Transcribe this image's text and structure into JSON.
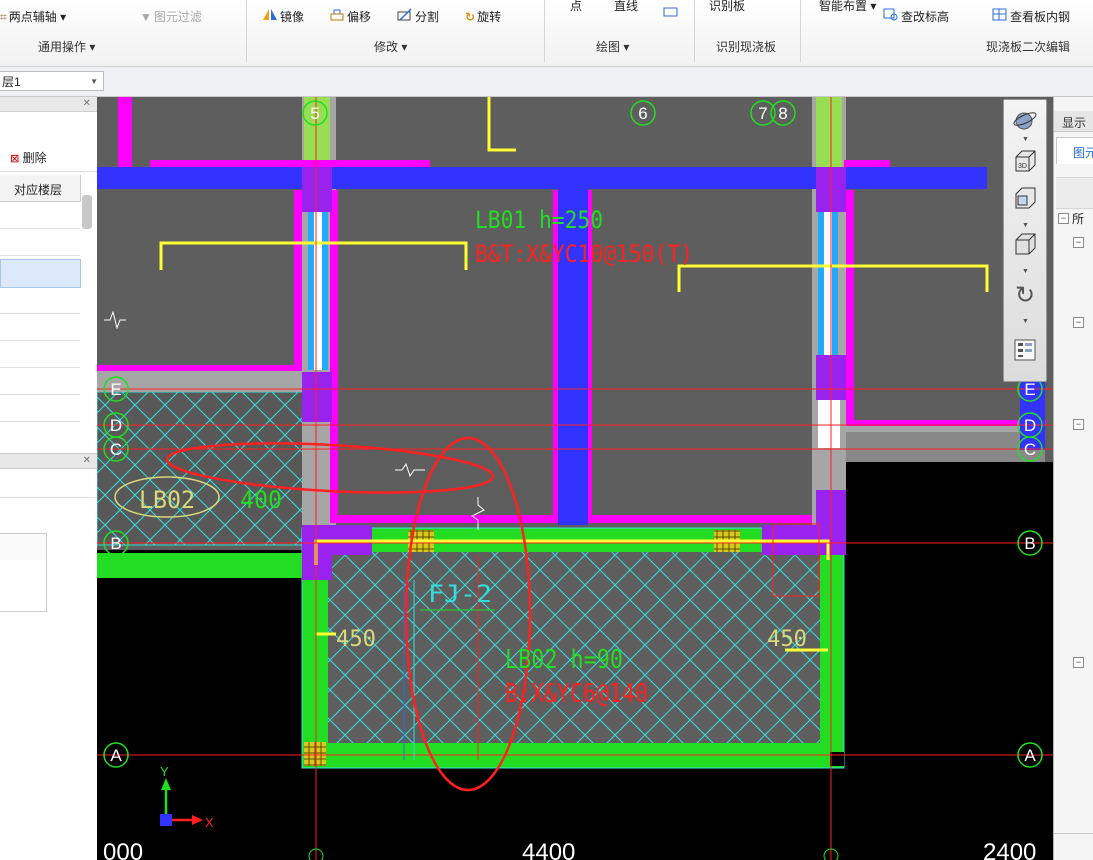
{
  "ribbon": {
    "groups": [
      {
        "label": "通用操作 ▾",
        "items": [
          {
            "icon": "axis-icon",
            "label": "两点辅轴 ▾"
          },
          {
            "icon": "filter-icon",
            "label": "图元过滤",
            "disabled": true
          }
        ]
      },
      {
        "label": "修改 ▾",
        "items": [
          {
            "icon": "mirror-icon",
            "label": "镜像"
          },
          {
            "icon": "offset-icon",
            "label": "偏移"
          },
          {
            "icon": "split-icon",
            "label": "分割"
          },
          {
            "icon": "rotate-icon",
            "label": "旋转"
          }
        ]
      },
      {
        "label": "绘图 ▾",
        "items": [
          {
            "icon": "point-icon",
            "label": "点"
          },
          {
            "icon": "line-icon",
            "label": "直线"
          }
        ]
      },
      {
        "label": "识别现浇板",
        "items": [
          {
            "icon": "recognize-slab-icon",
            "label": "识别板"
          }
        ]
      },
      {
        "label": "现浇板二次编辑",
        "items": [
          {
            "icon": "smart-layout-icon",
            "label": "智能布置 ▾"
          },
          {
            "icon": "check-elevation-icon",
            "label": "查改标高"
          },
          {
            "icon": "view-slab-rebar-icon",
            "label": "查看板内钢"
          }
        ]
      }
    ]
  },
  "layer_selector": {
    "value": "层1"
  },
  "left_panel": {
    "delete_label": "删除",
    "column_header": "对应楼层"
  },
  "right_panel": {
    "title": "显示",
    "tab": "图元",
    "tree_label": "所"
  },
  "view_toolbar": {
    "buttons": [
      "orbit-icon",
      "view-3d-icon",
      "view-top-icon",
      "view-box-icon",
      "rotate-view-icon",
      "display-settings-icon"
    ],
    "button_3d_text": "3D"
  },
  "drawing": {
    "grid_top": [
      "5",
      "6",
      "7",
      "8"
    ],
    "grid_side": [
      "E",
      "D",
      "C",
      "B",
      "A"
    ],
    "slab1_name": "LB01 h=250",
    "slab1_rebar": "B&T:X&YC10@150(T)",
    "slab2_name": "LB02 h=90",
    "slab2_rebar": "B:X&YC6@140",
    "slab_left_label": "LB02",
    "slab_left_value": "400",
    "pit_label": "FJ-2",
    "dim_left": "450",
    "dim_right": "450",
    "bottom_dims": [
      "000",
      "4400",
      "2400"
    ],
    "axis_y": "Y",
    "axis_x": "X"
  },
  "colors": {
    "beam": "#3333ff",
    "wall": "#ff00ff",
    "slab": "#5e5e5e",
    "grid": "#ff2020",
    "green": "#22dd22",
    "hatch": "#33dddd",
    "annotation": "#ff2020"
  }
}
